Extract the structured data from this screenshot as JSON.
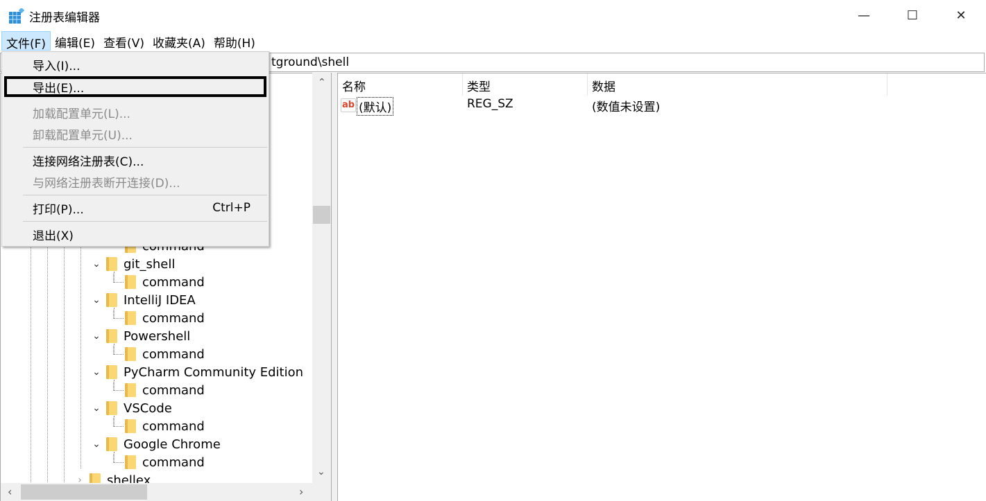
{
  "window": {
    "title": "注册表编辑器",
    "minimize": "—",
    "maximize": "☐",
    "close": "✕"
  },
  "menubar": [
    "文件(F)",
    "编辑(E)",
    "查看(V)",
    "收藏夹(A)",
    "帮助(H)"
  ],
  "address": "tground\\shell",
  "file_menu": {
    "items": [
      {
        "label": "导入(I)...",
        "disabled": false
      },
      {
        "label": "导出(E)...",
        "disabled": false,
        "focused": true
      },
      {
        "label": "加载配置单元(L)...",
        "disabled": true
      },
      {
        "label": "卸载配置单元(U)...",
        "disabled": true
      },
      {
        "label": "连接网络注册表(C)...",
        "disabled": false
      },
      {
        "label": "与网络注册表断开连接(D)...",
        "disabled": true
      },
      {
        "label": "打印(P)...",
        "disabled": false,
        "shortcut": "Ctrl+P"
      },
      {
        "label": "退出(X)",
        "disabled": false
      }
    ]
  },
  "tree": {
    "rows": [
      {
        "label": "command",
        "level": "child"
      },
      {
        "label": "git_shell",
        "level": "parent"
      },
      {
        "label": "command",
        "level": "child"
      },
      {
        "label": "IntelliJ IDEA",
        "level": "parent"
      },
      {
        "label": "command",
        "level": "child"
      },
      {
        "label": "Powershell",
        "level": "parent"
      },
      {
        "label": "command",
        "level": "child"
      },
      {
        "label": "PyCharm Community Edition",
        "level": "parent"
      },
      {
        "label": "command",
        "level": "child"
      },
      {
        "label": "VSCode",
        "level": "parent"
      },
      {
        "label": "command",
        "level": "child"
      },
      {
        "label": "Google Chrome",
        "level": "parent"
      },
      {
        "label": "command",
        "level": "child"
      },
      {
        "label": "shellex",
        "level": "collapsed"
      }
    ]
  },
  "list": {
    "headers": [
      "名称",
      "类型",
      "数据"
    ],
    "rows": [
      {
        "name": "(默认)",
        "type": "REG_SZ",
        "data": "(数值未设置)",
        "icon": "string-value-icon"
      }
    ]
  }
}
